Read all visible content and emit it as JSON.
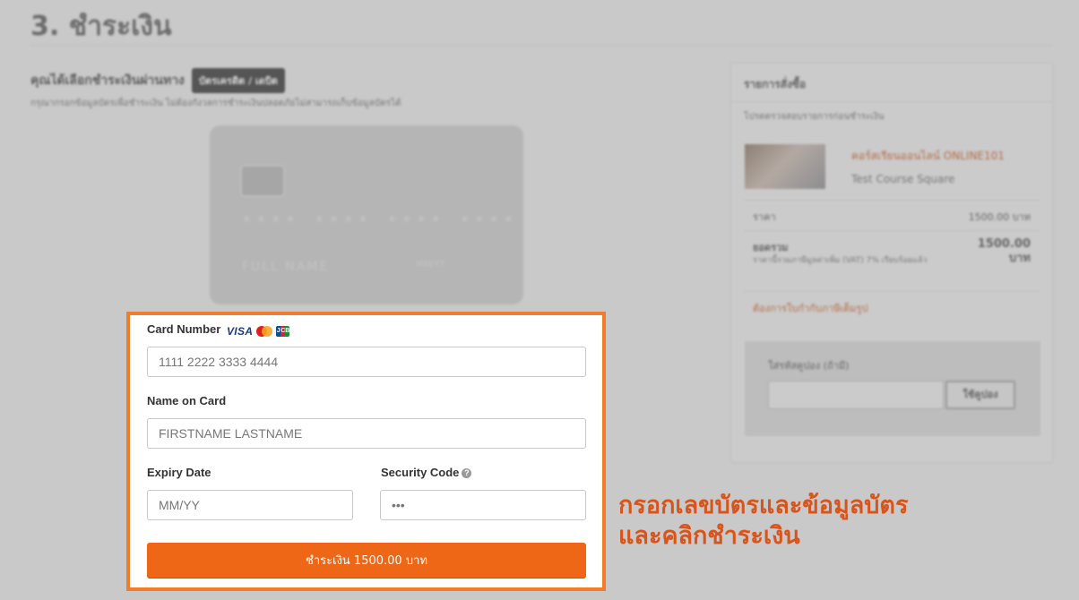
{
  "page": {
    "heading": "3. ชำระเงิน",
    "method_prefix": "คุณได้เลือกชำระเงินผ่านทาง",
    "method_badge": "บัตรเครดิต / เดบิต",
    "method_hint": "กรุณากรอกข้อมูลบัตรเพื่อชำระเงิน ไม่ต้องกังวลการชำระเงินปลอดภัยไม่สามารถเก็บข้อมูลบัตรได้"
  },
  "card_preview": {
    "number_mask": "**** **** **** ****",
    "holder": "FULL NAME",
    "expiry": "MM/YY"
  },
  "sidebar": {
    "title": "รายการสั่งซื้อ",
    "note": "โปรดตรวจสอบรายการก่อนชำระเงิน",
    "course_name": "คอร์สเรียนออนไลน์ ONLINE101",
    "course_sub": "Test Course Square",
    "price_label": "ราคา",
    "price_value": "1500.00 บาท",
    "total_label": "ยอดรวม",
    "total_note": "ราคานี้รวมภาษีมูลค่าเพิ่ม (VAT) 7% เรียบร้อยแล้ว",
    "total_value_line1": "1500.00",
    "total_value_line2": "บาท",
    "link": "ต้องการใบกำกับภาษีเต็มรูป",
    "coupon_label": "ใส่รหัสคูปอง (ถ้ามี)",
    "coupon_button": "ใช้คูปอง"
  },
  "form": {
    "card_number_label": "Card Number",
    "card_brands": [
      "VISA",
      "mastercard",
      "JCB"
    ],
    "card_number_placeholder": "1111 2222 3333 4444",
    "name_label": "Name on Card",
    "name_placeholder": "FIRSTNAME LASTNAME",
    "expiry_label": "Expiry Date",
    "expiry_placeholder": "MM/YY",
    "cvc_label": "Security Code",
    "cvc_placeholder": "•••",
    "pay_button": "ชำระเงิน 1500.00 บาท"
  },
  "instruction": {
    "line1": "กรอกเลขบัตรและข้อมูลบัตร",
    "line2": "และคลิกชำระเงิน"
  },
  "colors": {
    "accent": "#ed6716",
    "highlight_border": "#ef7d2e",
    "instruction_text": "#d9541b"
  }
}
